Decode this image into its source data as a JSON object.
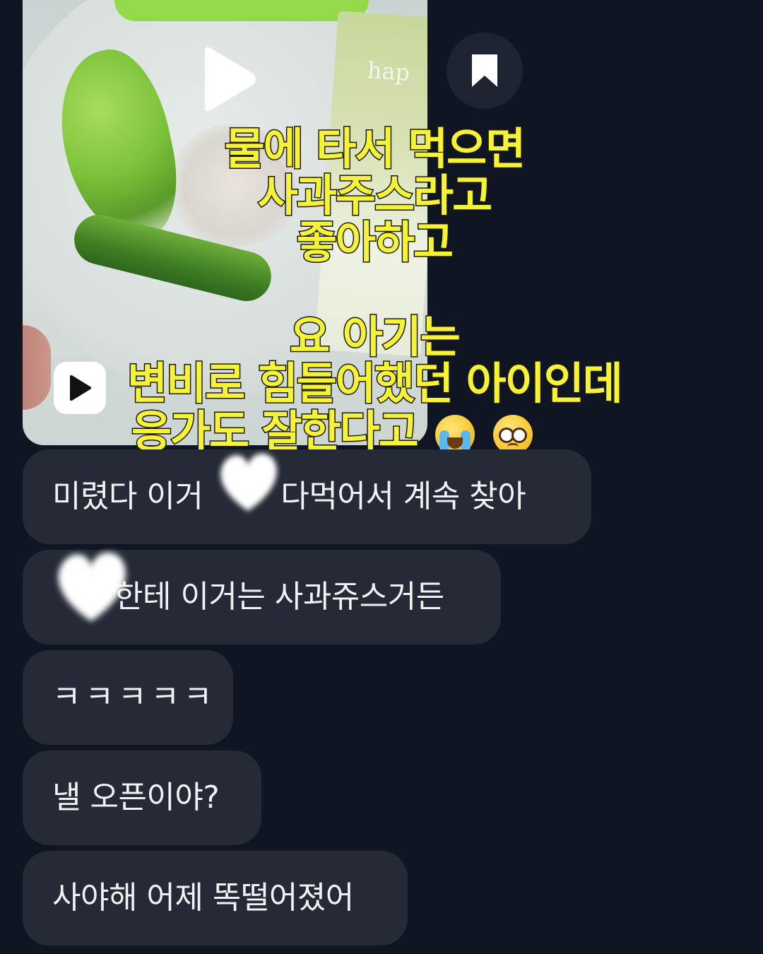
{
  "media_card": {
    "brand_text": "hap",
    "caption_lines": [
      "물에 타서 먹으면",
      "사과주스라고",
      "좋아하고",
      "",
      "요 아기는",
      "변비로 힘들어했던 아이인데",
      "응가도 잘한다고"
    ],
    "emoji_icons": [
      "loudly-crying-face-icon",
      "pleading-face-icon"
    ]
  },
  "icons": {
    "play_big": "play-icon",
    "play_small": "video-play-icon",
    "bookmark": "bookmark-icon"
  },
  "messages": [
    {
      "text": "미렸다 이거 다먹어서 계속 찾아",
      "before": "미렸다 이거",
      "after": " 다먹어서 계속 찾아"
    },
    {
      "text": "한테 이거는 사과쥬스거든"
    },
    {
      "text": "ㅋㅋㅋㅋㅋ"
    },
    {
      "text": "낼 오픈이야?"
    },
    {
      "text": "사야해 어제 똑떨어졌어"
    }
  ]
}
